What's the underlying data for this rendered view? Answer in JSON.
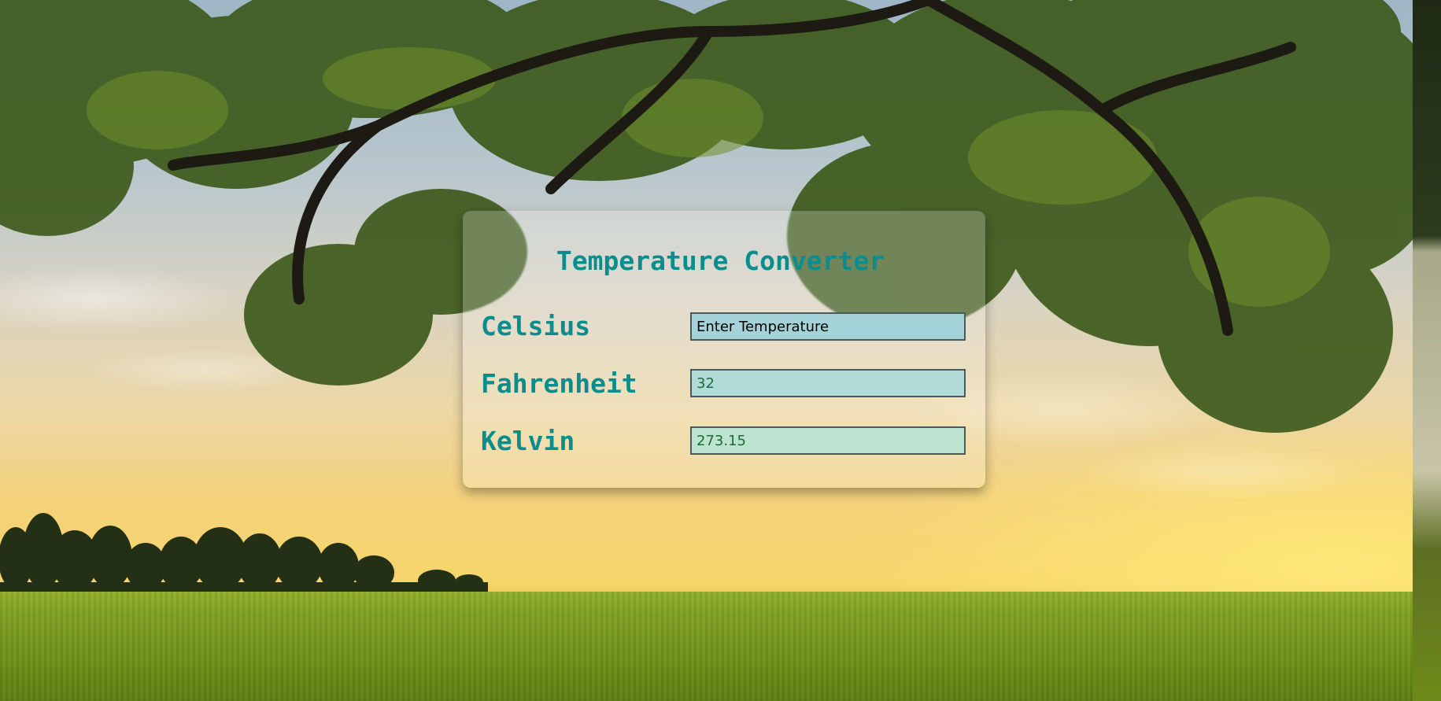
{
  "app": {
    "title": "Temperature Converter"
  },
  "colors": {
    "accent": "#0c8d8d",
    "field_background": "#a3d3d9",
    "field_value_text": "#1d6a3a"
  },
  "background": {
    "description_icon": "landscape-photo"
  },
  "fields": {
    "celsius": {
      "label": "Celsius",
      "value": "",
      "placeholder": "Enter Temperature"
    },
    "fahrenheit": {
      "label": "Fahrenheit",
      "value": "32"
    },
    "kelvin": {
      "label": "Kelvin",
      "value": "273.15"
    }
  }
}
